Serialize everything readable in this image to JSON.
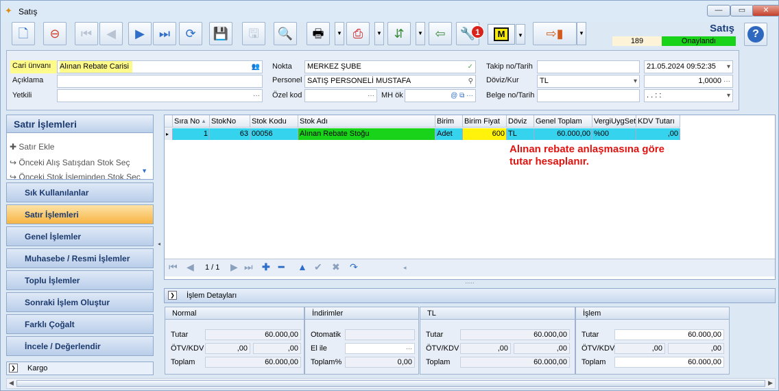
{
  "window": {
    "title": "Satış"
  },
  "header": {
    "title": "Satış",
    "number": "189",
    "status": "Onaylandı",
    "status_color": "#19d21a"
  },
  "toolbar": {
    "badge": "1",
    "m_label": "M"
  },
  "form": {
    "cari_label": "Cari ünvanı",
    "cari_value": "Alınan Rebate Carisi",
    "aciklama_label": "Açıklama",
    "aciklama_value": "",
    "yetkili_label": "Yetkili",
    "yetkili_value": "",
    "nokta_label": "Nokta",
    "nokta_value": "MERKEZ ŞUBE",
    "personel_label": "Personel",
    "personel_value": "SATIŞ PERSONELİ MUSTAFA",
    "ozel_kod_label": "Özel kod",
    "ozel_kod_value": "",
    "mh_ok_label": "MH ök",
    "mh_ok_value": "",
    "takip_label": "Takip no/Tarih",
    "takip_value": "",
    "takip_date": "21.05.2024 09:52:35",
    "doviz_label": "Döviz/Kur",
    "doviz_value": "TL",
    "kur_value": "1,0000",
    "belge_label": "Belge no/Tarih",
    "belge_value": "",
    "belge_date": ". .   : :"
  },
  "left_panel": {
    "title": "Satır İşlemleri",
    "links": [
      "Satır Ekle",
      "Önceki Alış Satışdan Stok Seç",
      "Önceki Stok İşleminden Stok Seç"
    ],
    "buttons": [
      "Sık Kullanılanlar",
      "Satır İşlemleri",
      "Genel İşlemler",
      "Muhasebe / Resmi İşlemler",
      "Toplu İşlemler",
      "Sonraki İşlem Oluştur",
      "Farklı Çoğalt",
      "İncele / Değerlendir"
    ],
    "active_button": "Satır İşlemleri",
    "kargo": "Kargo"
  },
  "grid": {
    "columns": [
      "Sıra No",
      "StokNo",
      "Stok Kodu",
      "Stok Adı",
      "Birim",
      "Birim Fiyat",
      "Döviz",
      "Genel Toplam",
      "VergiUygSet",
      "KDV Tutarı"
    ],
    "rows": [
      {
        "sira": "1",
        "stokno": "63",
        "stok_kodu": "00056",
        "stok_adi": "Alınan Rebate Stoğu",
        "birim": "Adet",
        "birim_fiyat": "600",
        "doviz": "TL",
        "genel_toplam": "60.000,00",
        "vergi": "%00",
        "kdv": ",00"
      }
    ],
    "note": "Alınan rebate anlaşmasına göre tutar hesaplanır.",
    "note_color": "#e0130f",
    "page": "1 / 1"
  },
  "details": {
    "title": "İşlem Detayları",
    "normal": {
      "title": "Normal",
      "tutar_label": "Tutar",
      "tutar": "60.000,00",
      "otv_label": "ÖTV/KDV",
      "otv": ",00",
      "kdv": ",00",
      "toplam_label": "Toplam",
      "toplam": "60.000,00"
    },
    "indirimler": {
      "title": "İndirimler",
      "otomatik_label": "Otomatik",
      "otomatik": "",
      "elile_label": "El ile",
      "elile": "",
      "toplam_label": "Toplam%",
      "toplam": "0,00"
    },
    "tl": {
      "title": "TL",
      "tutar_label": "Tutar",
      "tutar": "60.000,00",
      "otv_label": "ÖTV/KDV",
      "otv": ",00",
      "kdv": ",00",
      "toplam_label": "Toplam",
      "toplam": "60.000,00"
    },
    "islem": {
      "title": "İşlem",
      "tutar_label": "Tutar",
      "tutar": "60.000,00",
      "otv_label": "ÖTV/KDV",
      "otv": ",00",
      "kdv": ",00",
      "toplam_label": "Toplam",
      "toplam": "60.000,00"
    }
  }
}
